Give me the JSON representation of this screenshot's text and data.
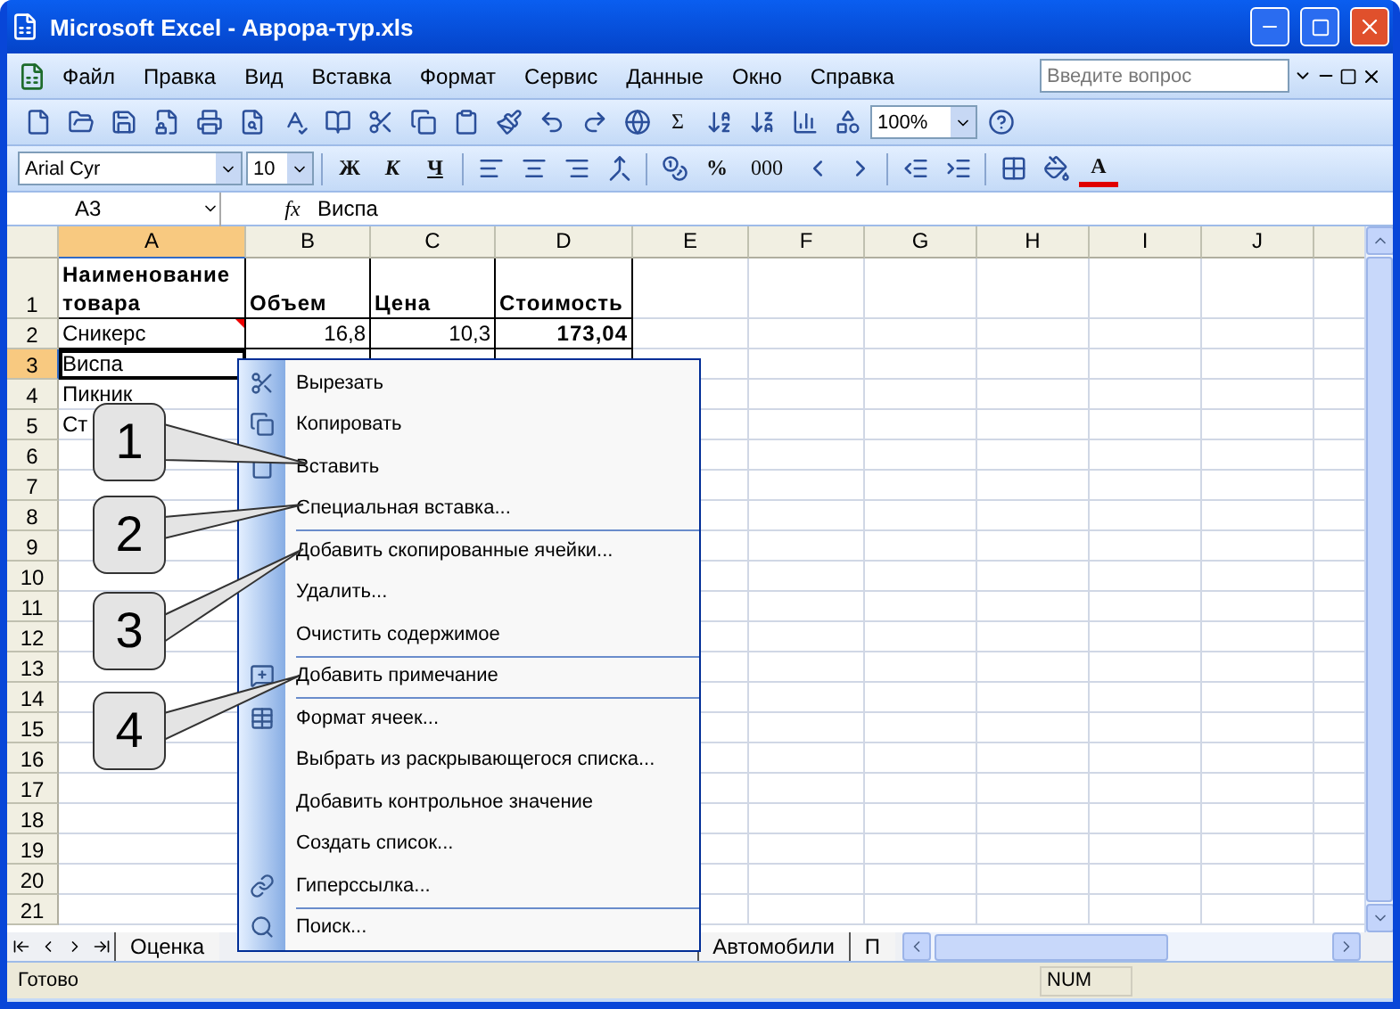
{
  "window": {
    "title": "Microsoft Excel - Аврора-тур.xls"
  },
  "menu": [
    "Файл",
    "Правка",
    "Вид",
    "Вставка",
    "Формат",
    "Сервис",
    "Данные",
    "Окно",
    "Справка"
  ],
  "help_search": {
    "placeholder": "Введите вопрос"
  },
  "toolbar": {
    "sum": "Σ",
    "zoom": "100%"
  },
  "format_toolbar": {
    "font": "Arial Cyr",
    "size": "10",
    "bold": "Ж",
    "italic": "К",
    "underline": "Ч",
    "percent": "%",
    "thousands": "000",
    "font_color": "A"
  },
  "formula_bar": {
    "name_box": "А3",
    "fx": "fx",
    "value": "Виспа"
  },
  "columns": [
    {
      "label": "A",
      "selected": true
    },
    {
      "label": "B",
      "selected": false
    },
    {
      "label": "C",
      "selected": false
    },
    {
      "label": "D",
      "selected": false
    },
    {
      "label": "E",
      "selected": false
    },
    {
      "label": "F",
      "selected": false
    },
    {
      "label": "G",
      "selected": false
    },
    {
      "label": "H",
      "selected": false
    },
    {
      "label": "I",
      "selected": false
    },
    {
      "label": "J",
      "selected": false
    }
  ],
  "rows": [
    {
      "label": "1",
      "selected": false,
      "tall": true,
      "cells": [
        {
          "text": "Наименование товара",
          "bold": true,
          "numeric": false
        },
        {
          "text": "Объем",
          "bold": true,
          "numeric": false
        },
        {
          "text": "Цена",
          "bold": true,
          "numeric": false
        },
        {
          "text": "Стоимость",
          "bold": true,
          "numeric": false
        }
      ]
    },
    {
      "label": "2",
      "selected": false,
      "tall": false,
      "cells": [
        {
          "text": "Сникерс",
          "bold": false,
          "numeric": false,
          "comment": true
        },
        {
          "text": "16,8",
          "bold": false,
          "numeric": true
        },
        {
          "text": "10,3",
          "bold": false,
          "numeric": true
        },
        {
          "text": "173,04",
          "bold": true,
          "numeric": true
        }
      ]
    },
    {
      "label": "3",
      "selected": true,
      "tall": false,
      "cells": [
        {
          "text": "Виспа",
          "bold": false,
          "numeric": false
        }
      ]
    },
    {
      "label": "4",
      "selected": false,
      "tall": false,
      "cells": [
        {
          "text": "Пикник",
          "bold": false,
          "numeric": false
        }
      ]
    },
    {
      "label": "5",
      "selected": false,
      "tall": false,
      "cells": [
        {
          "text": "Ст",
          "bold": false,
          "numeric": false
        }
      ]
    },
    {
      "label": "6",
      "selected": false,
      "tall": false,
      "cells": []
    },
    {
      "label": "7",
      "selected": false,
      "tall": false,
      "cells": []
    },
    {
      "label": "8",
      "selected": false,
      "tall": false,
      "cells": []
    },
    {
      "label": "9",
      "selected": false,
      "tall": false,
      "cells": []
    },
    {
      "label": "10",
      "selected": false,
      "tall": false,
      "cells": []
    },
    {
      "label": "11",
      "selected": false,
      "tall": false,
      "cells": []
    },
    {
      "label": "12",
      "selected": false,
      "tall": false,
      "cells": []
    },
    {
      "label": "13",
      "selected": false,
      "tall": false,
      "cells": []
    },
    {
      "label": "14",
      "selected": false,
      "tall": false,
      "cells": []
    },
    {
      "label": "15",
      "selected": false,
      "tall": false,
      "cells": []
    },
    {
      "label": "16",
      "selected": false,
      "tall": false,
      "cells": []
    },
    {
      "label": "17",
      "selected": false,
      "tall": false,
      "cells": []
    },
    {
      "label": "18",
      "selected": false,
      "tall": false,
      "cells": []
    },
    {
      "label": "19",
      "selected": false,
      "tall": false,
      "cells": []
    },
    {
      "label": "20",
      "selected": false,
      "tall": false,
      "cells": []
    },
    {
      "label": "21",
      "selected": false,
      "tall": false,
      "cells": []
    }
  ],
  "sheet_tabs": [
    {
      "label": "Оценка",
      "selected": false
    },
    {
      "label": "Автомобили",
      "selected": false
    },
    {
      "label": "П",
      "selected": false
    }
  ],
  "context_menu": [
    {
      "label": "Вырезать",
      "separator_before": false
    },
    {
      "label": "Копировать",
      "separator_before": false
    },
    {
      "label": "Вставить",
      "separator_before": false
    },
    {
      "label": "Специальная вставка...",
      "separator_before": false
    },
    {
      "label": "Добавить скопированные ячейки...",
      "separator_before": true
    },
    {
      "label": "Удалить...",
      "separator_before": false
    },
    {
      "label": "Очистить содержимое",
      "separator_before": false
    },
    {
      "label": "Добавить примечание",
      "separator_before": true
    },
    {
      "label": "Формат ячеек...",
      "separator_before": true
    },
    {
      "label": "Выбрать из раскрывающегося списка...",
      "separator_before": false
    },
    {
      "label": "Добавить контрольное значение",
      "separator_before": false
    },
    {
      "label": "Создать список...",
      "separator_before": false
    },
    {
      "label": "Гиперссылка...",
      "separator_before": false
    },
    {
      "label": "Поиск...",
      "separator_before": true
    }
  ],
  "callouts": [
    "1",
    "2",
    "3",
    "4"
  ],
  "status_bar": {
    "status": "Готово",
    "num": "NUM"
  }
}
